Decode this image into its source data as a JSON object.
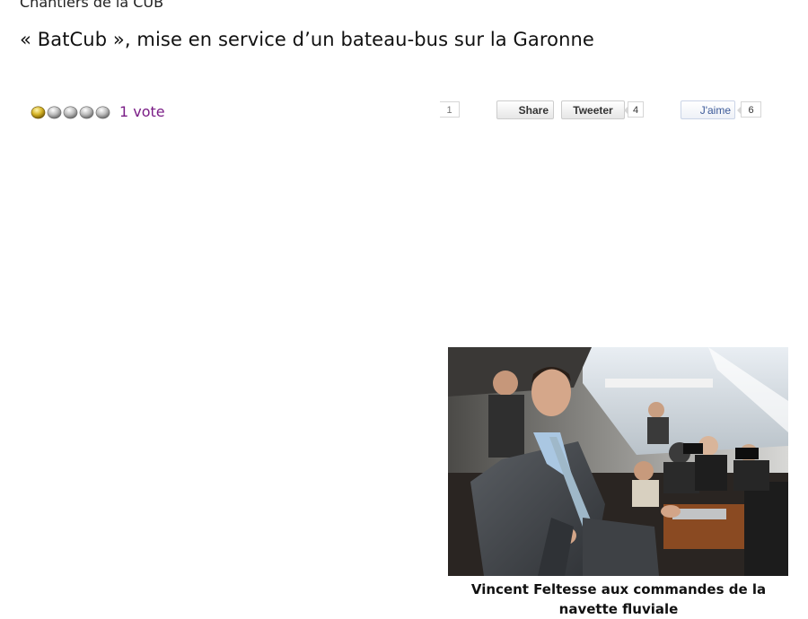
{
  "breadcrumb": "Chantiers de la CUB",
  "article": {
    "title": "« BatCub », mise en service d’un bateau-bus sur la Garonne"
  },
  "rating": {
    "vote_label": "1 vote",
    "score": 1,
    "max": 5,
    "colors": {
      "filled": "#c9a91c",
      "empty": "#bdbdbd"
    }
  },
  "social": {
    "share_count": "1",
    "share_label": "Share",
    "tweet_label": "Tweeter",
    "tweet_count": "4",
    "like_label": "J'aime",
    "like_count": "6"
  },
  "photo": {
    "caption": "Vincent Feltesse aux commandes de la navette fluviale"
  }
}
